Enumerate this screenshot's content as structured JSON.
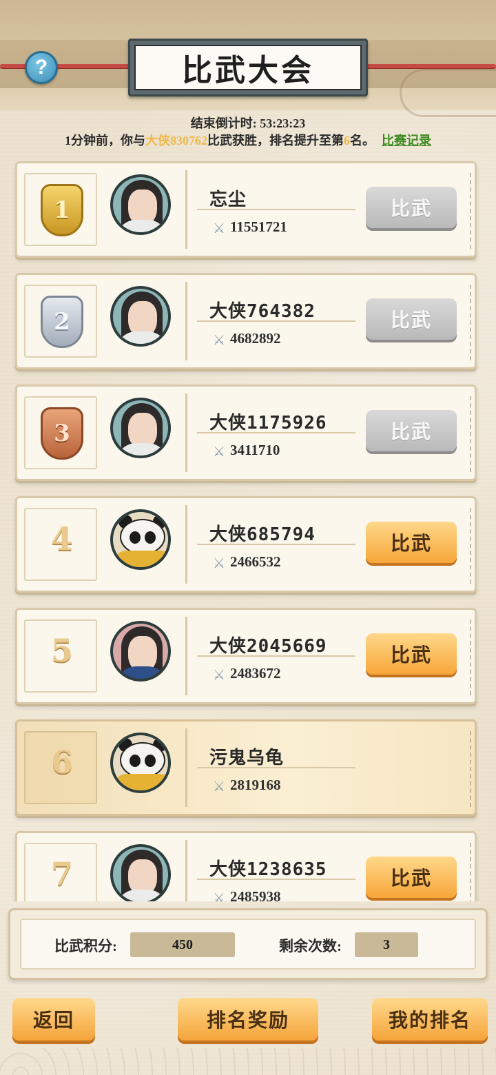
{
  "header": {
    "title": "比武大会",
    "help_icon_glyph": "?"
  },
  "countdown": {
    "label": "结束倒计时:",
    "value": "53:23:23"
  },
  "notice": {
    "prefix": "1分钟前，你与",
    "opponent": "大侠830762",
    "middle": "比武获胜，排名提升至第",
    "rank": "6",
    "suffix": "名。",
    "record_link": "比赛记录"
  },
  "fight_label": "比武",
  "rankings": [
    {
      "rank": "1",
      "name": "忘尘",
      "power": "11551721",
      "badge": "gold",
      "avatar": "swordsman-crown-avatar",
      "button": "gray"
    },
    {
      "rank": "2",
      "name": "大侠764382",
      "power": "4682892",
      "badge": "silver",
      "avatar": "swordsman-white-avatar",
      "button": "gray"
    },
    {
      "rank": "3",
      "name": "大侠1175926",
      "power": "3411710",
      "badge": "bronze",
      "avatar": "swordsman-white-avatar",
      "button": "gray"
    },
    {
      "rank": "4",
      "name": "大侠685794",
      "power": "2466532",
      "badge": "plain",
      "avatar": "panda-avatar",
      "button": "orange"
    },
    {
      "rank": "5",
      "name": "大侠2045669",
      "power": "2483672",
      "badge": "plain",
      "avatar": "female-avatar",
      "button": "orange"
    },
    {
      "rank": "6",
      "name": "污鬼乌龟",
      "power": "2819168",
      "badge": "plain",
      "avatar": "panda-avatar",
      "button": "none",
      "is_me": true
    },
    {
      "rank": "7",
      "name": "大侠1238635",
      "power": "2485938",
      "badge": "plain",
      "avatar": "swordsman-crown-avatar",
      "button": "orange"
    }
  ],
  "score_panel": {
    "points_label": "比武积分:",
    "points_value": "450",
    "remaining_label": "剩余次数:",
    "remaining_value": "3"
  },
  "bottom_buttons": {
    "back": "返回",
    "rewards": "排名奖励",
    "my_rank": "我的排名"
  },
  "colors": {
    "highlight": "#f0b84a",
    "link": "#3f8a22",
    "button_orange": "#f7a63a",
    "button_gray": "#b9b9b9"
  },
  "power_icon": "crossed-swords-icon"
}
